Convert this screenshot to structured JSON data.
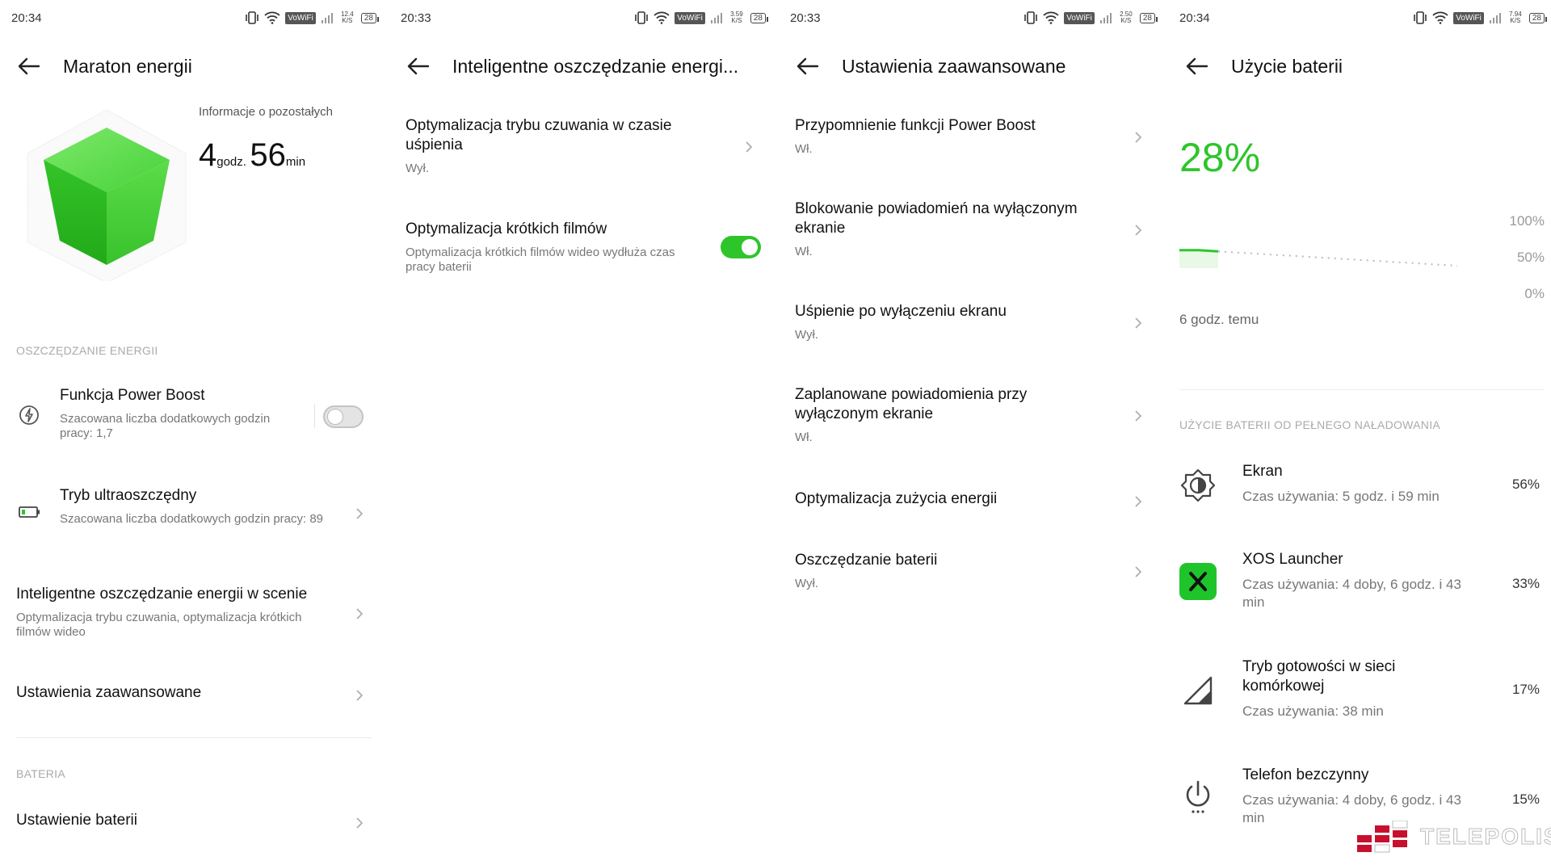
{
  "panel1": {
    "status_time": "20:34",
    "status_speed": "12.4 K/S",
    "status_vowifi": "VoWiFi",
    "status_battery": "28",
    "title": "Maraton energii",
    "info_label": "Informacje o pozostałych",
    "remaining_hours": "4",
    "remaining_hours_unit": "godz.",
    "remaining_minutes": "56",
    "remaining_minutes_unit": "min",
    "section_energy": "OSZCZĘDZANIE ENERGII",
    "power_boost": {
      "title": "Funkcja Power Boost",
      "sub": "Szacowana liczba dodatkowych godzin pracy: 1,7",
      "toggle_on": false
    },
    "ultra_saving": {
      "title": "Tryb ultraoszczędny",
      "sub": "Szacowana liczba dodatkowych godzin pracy: 89"
    },
    "smart_saving": {
      "title": "Inteligentne oszczędzanie energii w scenie",
      "sub": "Optymalizacja trybu czuwania, optymalizacja krótkich filmów wideo"
    },
    "advanced": {
      "title": "Ustawienia zaawansowane"
    },
    "section_battery": "BATERIA",
    "battery_settings": {
      "title": "Ustawienie baterii"
    }
  },
  "panel2": {
    "status_time": "20:33",
    "status_speed": "3.59 K/S",
    "status_vowifi": "VoWiFi",
    "status_battery": "28",
    "title": "Inteligentne oszczędzanie energi...",
    "standby_opt": {
      "title": "Optymalizacja trybu czuwania w czasie uśpienia",
      "sub": "Wył."
    },
    "short_video": {
      "title": "Optymalizacja krótkich filmów",
      "sub": "Optymalizacja krótkich filmów wideo wydłuża czas pracy baterii",
      "toggle_on": true
    }
  },
  "panel3": {
    "status_time": "20:33",
    "status_speed": "2.50 K/S",
    "status_vowifi": "VoWiFi",
    "status_battery": "28",
    "title": "Ustawienia zaawansowane",
    "items": [
      {
        "title": "Przypomnienie funkcji Power Boost",
        "sub": "Wł."
      },
      {
        "title": "Blokowanie powiadomień na wyłączonym ekranie",
        "sub": "Wł."
      },
      {
        "title": "Uśpienie po wyłączeniu ekranu",
        "sub": "Wył."
      },
      {
        "title": "Zaplanowane powiadomienia przy wyłączonym ekranie",
        "sub": "Wł."
      },
      {
        "title": "Optymalizacja zużycia energii",
        "sub": ""
      },
      {
        "title": "Oszczędzanie baterii",
        "sub": "Wył."
      }
    ]
  },
  "panel4": {
    "status_time": "20:34",
    "status_speed": "7.94 K/S",
    "status_vowifi": "VoWiFi",
    "status_battery": "28",
    "title": "Użycie baterii",
    "battery_level": "28%",
    "chart_ticks": [
      "100%",
      "50%",
      "0%"
    ],
    "chart_time_label": "6 godz. temu",
    "section_usage": "UŻYCIE BATERII OD PEŁNEGO NAŁADOWANIA",
    "usage": [
      {
        "name": "Ekran",
        "time": "Czas używania: 5 godz. i 59 min",
        "pct": "56%",
        "icon": "brightness-icon"
      },
      {
        "name": "XOS Launcher",
        "time": "Czas używania: 4 doby, 6 godz. i 43 min",
        "pct": "33%",
        "icon": "xos-launcher-icon"
      },
      {
        "name": "Tryb gotowości w sieci komórkowej",
        "time": "Czas używania: 38 min",
        "pct": "17%",
        "icon": "cell-signal-icon"
      },
      {
        "name": "Telefon bezczynny",
        "time": "Czas używania: 4 doby, 6 godz. i 43 min",
        "pct": "15%",
        "icon": "power-icon"
      }
    ]
  },
  "watermark": "TELEPOLIS",
  "colors": {
    "accent_green": "#2ec52b",
    "text": "#111111",
    "secondary": "#777777",
    "section": "#aaaaaa"
  },
  "chart_data": {
    "type": "line",
    "title": "",
    "ylabel": "",
    "ylim": [
      0,
      100
    ],
    "yticks": [
      "100%",
      "50%",
      "0%"
    ],
    "xlabel": "6 godz. temu",
    "series": [
      {
        "values": [
          30,
          30,
          28
        ]
      },
      {
        "values": [
          28,
          22,
          16,
          10,
          4
        ]
      }
    ]
  }
}
